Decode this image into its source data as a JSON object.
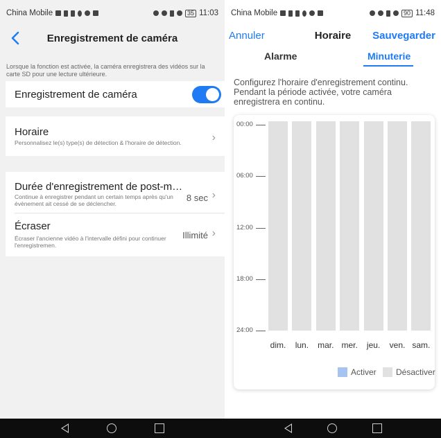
{
  "left": {
    "status": {
      "carrier": "China Mobile",
      "time": "11:03",
      "battery": "35"
    },
    "nav": {
      "title": "Enregistrement de caméra"
    },
    "info_note": "Lorsque la fonction est activée, la caméra enregistrera des vidéos sur la carte SD pour une lecture ultérieure.",
    "toggle_row": {
      "label": "Enregistrement de caméra",
      "enabled": true
    },
    "schedule_row": {
      "title": "Horaire",
      "desc": "Personnalisez le(s) type(s) de détection & l'horaire de détection."
    },
    "post_row": {
      "title": "Durée d'enregistrement de post-m…",
      "desc": "Continue à enregistrer pendant un certain temps après qu'un évènement ait cessé de se déclencher.",
      "value": "8 sec"
    },
    "overwrite_row": {
      "title": "Écraser",
      "desc": "Écraser l'ancienne vidéo à l'intervalle défini pour continuer l'enregistremen.",
      "value": "Illimité"
    }
  },
  "right": {
    "status": {
      "carrier": "China Mobile",
      "time": "11:48",
      "battery": "90"
    },
    "header": {
      "cancel": "Annuler",
      "title": "Horaire",
      "save": "Sauvegarder"
    },
    "tabs": {
      "alarm": "Alarme",
      "timer": "Minuterie",
      "active": "timer"
    },
    "description": "Configurez l'horaire d'enregistrement continu. Pendant la période activée, votre caméra enregistrera en continu.",
    "schedule": {
      "times": [
        "00:00",
        "06:00",
        "12:00",
        "18:00",
        "24:00"
      ],
      "days": [
        "dim.",
        "lun.",
        "mar.",
        "mer.",
        "jeu.",
        "ven.",
        "sam."
      ]
    },
    "legend": {
      "on": "Activer",
      "off": "Désactiver"
    },
    "colors": {
      "on": "#a7c3f2",
      "off": "#e1e1e1",
      "accent": "#1f7bf3"
    }
  }
}
